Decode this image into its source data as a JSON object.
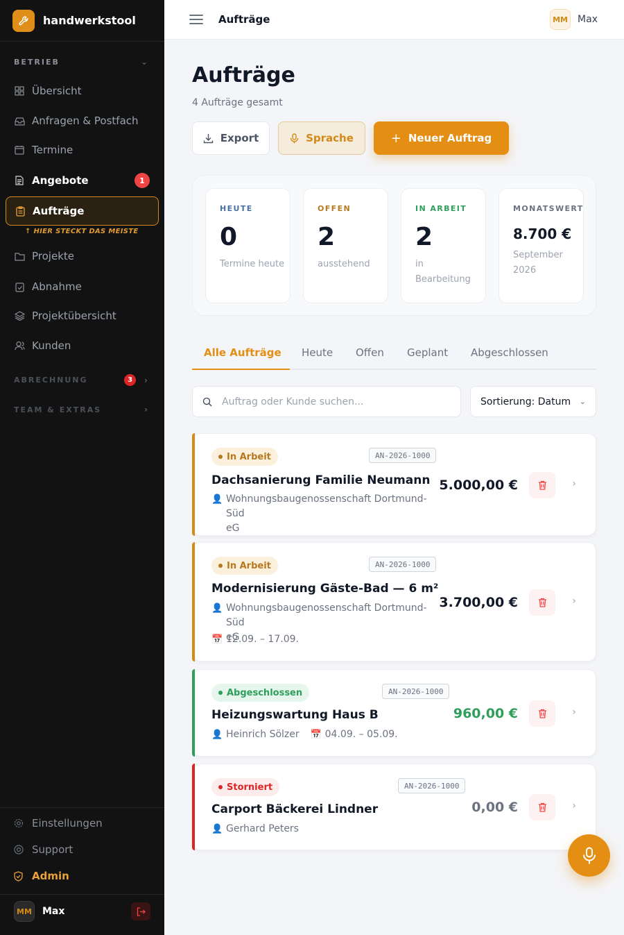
{
  "app": {
    "name": "handwerkstool"
  },
  "sidebar": {
    "sections": {
      "betrieb": "BETRIEB",
      "abrechnung": "ABRECHNUNG",
      "abrechnung_badge": "3",
      "team": "TEAM & EXTRAS"
    },
    "items": [
      {
        "label": "Übersicht",
        "icon": "grid-icon"
      },
      {
        "label": "Anfragen & Postfach",
        "icon": "inbox-icon"
      },
      {
        "label": "Termine",
        "icon": "calendar-icon"
      },
      {
        "label": "Angebote",
        "icon": "document-icon",
        "badge": "1"
      },
      {
        "label": "Aufträge",
        "icon": "clipboard-icon",
        "active": true
      },
      {
        "label": "Projekte",
        "icon": "folder-icon"
      },
      {
        "label": "Abnahme",
        "icon": "clipboard-check-icon"
      },
      {
        "label": "Projektübersicht",
        "icon": "layers-icon"
      },
      {
        "label": "Kunden",
        "icon": "users-icon"
      }
    ],
    "hint": "↑ HIER STECKT DAS MEISTE",
    "footer": {
      "settings": "Einstellungen",
      "support": "Support",
      "admin": "Admin"
    },
    "user": {
      "initials": "MM",
      "name": "Max"
    }
  },
  "topbar": {
    "title": "Aufträge",
    "user_initials": "MM",
    "user_name": "Max"
  },
  "page": {
    "title": "Aufträge",
    "subtitle": "4 Aufträge gesamt",
    "buttons": {
      "export": "Export",
      "voice": "Sprache",
      "new": "Neuer Auftrag"
    }
  },
  "stats": [
    {
      "label": "HEUTE",
      "value": "0",
      "desc": "Termine heute",
      "color": "#4a6fa5"
    },
    {
      "label": "OFFEN",
      "value": "2",
      "desc": "ausstehend",
      "color": "#b7791f"
    },
    {
      "label": "IN ARBEIT",
      "value": "2",
      "desc": "in Bearbeitung",
      "color": "#2f9e5b"
    },
    {
      "label": "MONATSWERT",
      "value": "8.700 €",
      "desc": "September 2026",
      "color": "#6b7280"
    }
  ],
  "tabs": [
    "Alle Aufträge",
    "Heute",
    "Offen",
    "Geplant",
    "Abgeschlossen"
  ],
  "search": {
    "placeholder": "Auftrag oder Kunde suchen..."
  },
  "sort": {
    "label": "Sortierung: Datum"
  },
  "orders": [
    {
      "status": "In Arbeit",
      "number": "AN-2026-1000",
      "title": "Dachsanierung Familie Neumann",
      "customer_line1": "Wohnungsbaugenossenschaft Dortmund-Süd",
      "customer_line2": "eG",
      "amount": "5.000,00 €"
    },
    {
      "status": "In Arbeit",
      "number": "AN-2026-1000",
      "title": "Modernisierung Gäste-Bad — 6 m²",
      "customer_line1": "Wohnungsbaugenossenschaft Dortmund-Süd",
      "customer_line2": "eG",
      "date": "12.09. – 17.09.",
      "amount": "3.700,00 €"
    },
    {
      "status": "Abgeschlossen",
      "number": "AN-2026-1000",
      "title": "Heizungswartung Haus B",
      "customer": "Heinrich Sölzer",
      "date": "04.09. – 05.09.",
      "amount": "960,00 €"
    },
    {
      "status": "Storniert",
      "number": "AN-2026-1000",
      "title": "Carport Bäckerei Lindner",
      "customer": "Gerhard Peters",
      "amount": "0,00 €"
    }
  ],
  "colors": {
    "accent": "#e48f14",
    "in_progress": "#d38a18",
    "done": "#2f9e5b",
    "cancelled": "#dc2626"
  }
}
